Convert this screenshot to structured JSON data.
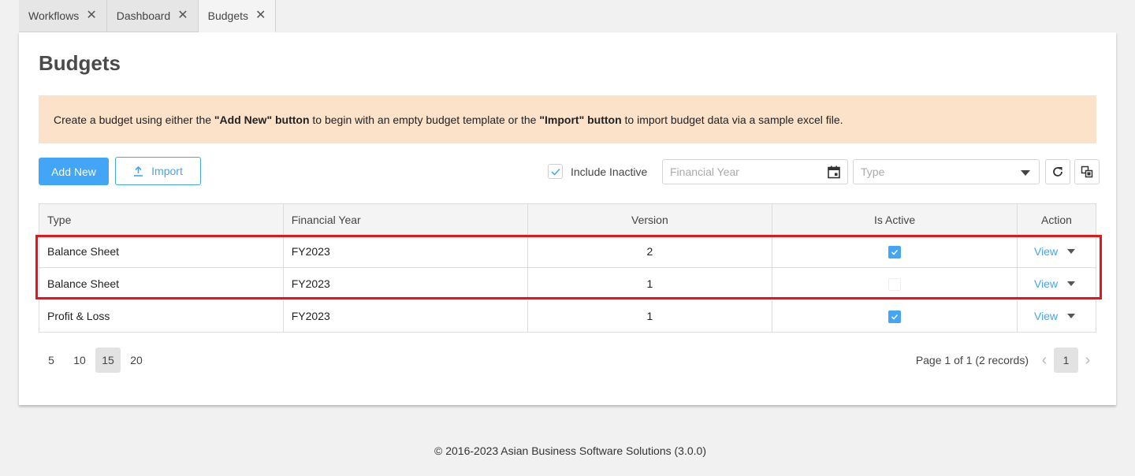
{
  "tabs": [
    {
      "label": "Workflows"
    },
    {
      "label": "Dashboard"
    },
    {
      "label": "Budgets"
    }
  ],
  "page": {
    "title": "Budgets"
  },
  "banner": {
    "t1": "Create a budget using either the ",
    "b1": "\"Add New\" button",
    "t2": " to begin with an empty budget template or the ",
    "b2": "\"Import\" button",
    "t3": " to import budget data via a sample excel file."
  },
  "toolbar": {
    "add_new": "Add New",
    "import": "Import",
    "include_inactive": "Include Inactive",
    "include_inactive_checked": true,
    "financial_year_placeholder": "Financial Year",
    "type_placeholder": "Type"
  },
  "table": {
    "headers": [
      "Type",
      "Financial Year",
      "Version",
      "Is Active",
      "Action"
    ],
    "rows": [
      {
        "type": "Balance Sheet",
        "year": "FY2023",
        "version": "2",
        "active": true,
        "action": "View"
      },
      {
        "type": "Balance Sheet",
        "year": "FY2023",
        "version": "1",
        "active": false,
        "action": "View"
      },
      {
        "type": "Profit & Loss",
        "year": "FY2023",
        "version": "1",
        "active": true,
        "action": "View"
      }
    ]
  },
  "pagination": {
    "sizes": [
      "5",
      "10",
      "15",
      "20"
    ],
    "selected_size": "15",
    "summary": "Page 1 of 1 (2 records)",
    "current_page": "1"
  },
  "footer": {
    "text": "© 2016-2023 Asian Business Software Solutions (3.0.0)"
  },
  "colors": {
    "accent": "#42a5f5",
    "banner": "#fbe2c8",
    "highlight": "#e3151d"
  }
}
